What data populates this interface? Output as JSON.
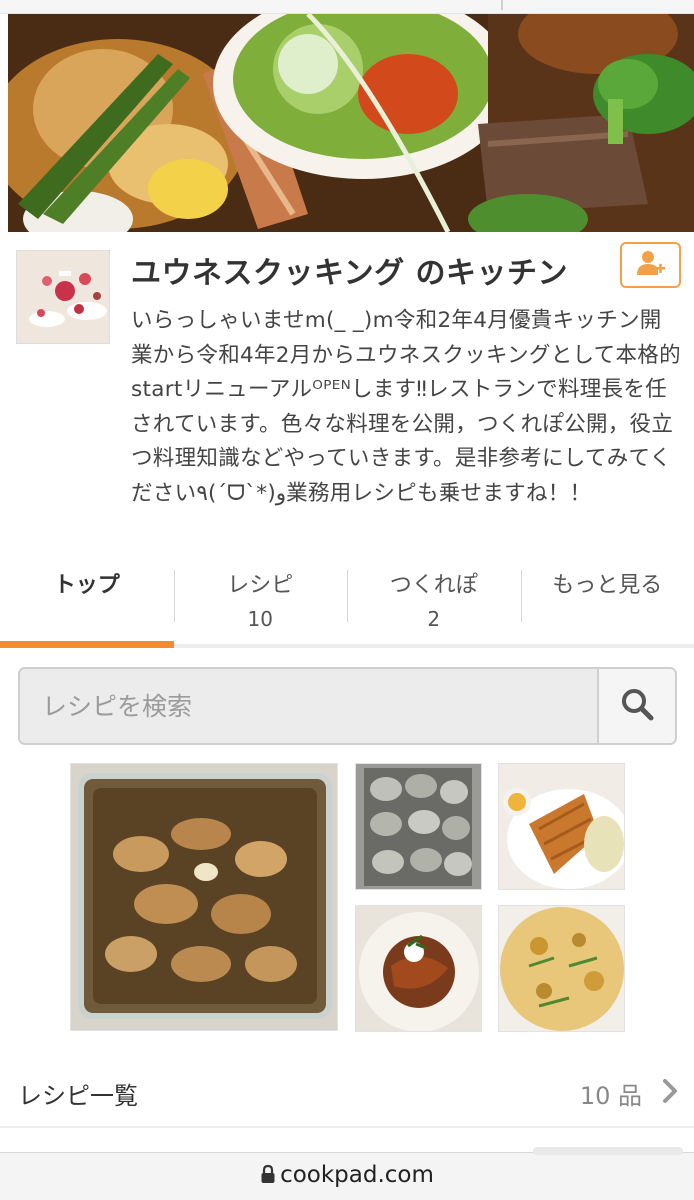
{
  "profile": {
    "kitchen_name": "ユウネスクッキング のキッチン",
    "intro": "いらっしゃいませm(_ _)m令和2年4月優貴キッチン開業から令和4年2月からユウネスクッキングとして本格的startリニューアルᴼᴾᴱᴺします‼︎レストランで料理長を任されています。色々な料理を公開，つくれぽ公開，役立つ料理知識などやっていきます。是非参考にしてみてください٩(ˊᗜˋ*)و業務用レシピも乗せますね！！",
    "follow_icon": "add-user-icon"
  },
  "tabs": [
    {
      "label": "トップ",
      "count": ""
    },
    {
      "label": "レシピ",
      "count": "10"
    },
    {
      "label": "つくれぽ",
      "count": "2"
    },
    {
      "label": "もっと見る",
      "count": ""
    }
  ],
  "search": {
    "placeholder": "レシピを検索",
    "icon": "search-icon"
  },
  "recipe_list": {
    "label": "レシピ一覧",
    "count": "10 品",
    "icon": "chevron-right-icon"
  },
  "browser": {
    "url": "cookpad.com",
    "icon": "lock-icon"
  },
  "colors": {
    "accent": "#f08c32",
    "follow_border": "#f0a14a"
  }
}
